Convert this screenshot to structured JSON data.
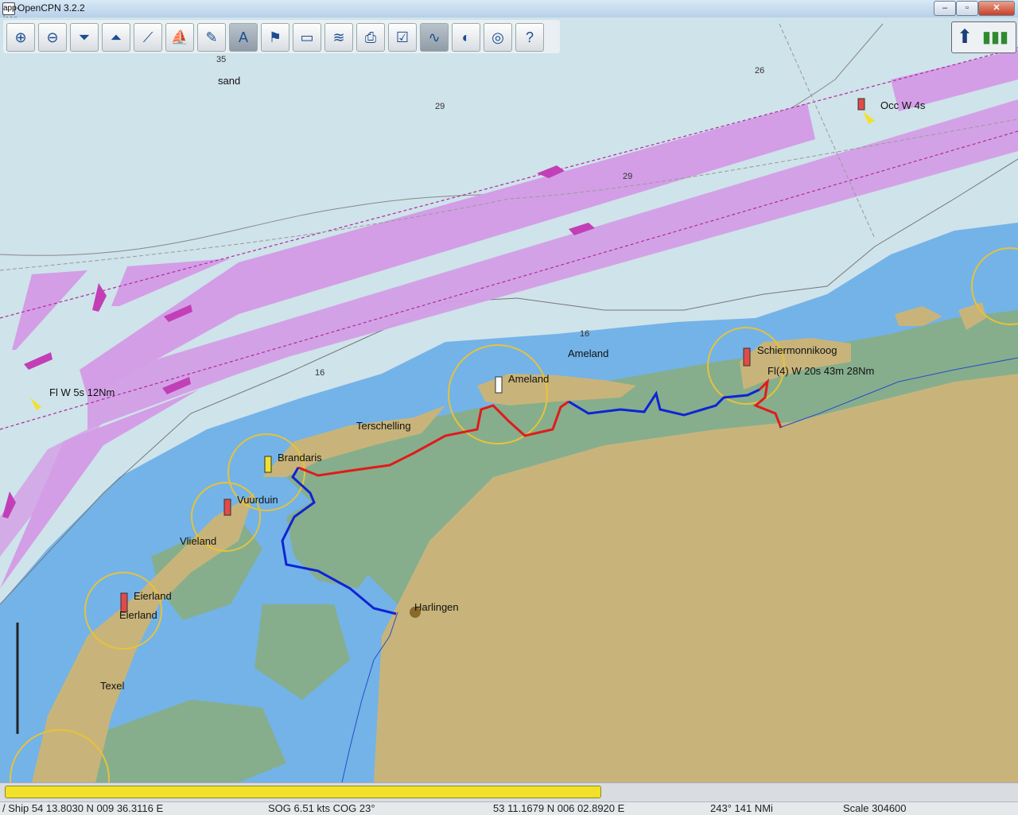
{
  "window": {
    "title": "OpenCPN 3.2.2",
    "icon": "app-icon",
    "minimize": "–",
    "maximize": "▫",
    "close": "✕"
  },
  "toolbar": {
    "buttons": [
      {
        "name": "zoom-in-icon",
        "glyph": "⊕"
      },
      {
        "name": "zoom-out-icon",
        "glyph": "⊖"
      },
      {
        "name": "scale-in-icon",
        "glyph": "⏷"
      },
      {
        "name": "scale-out-icon",
        "glyph": "⏶"
      },
      {
        "name": "route-icon",
        "glyph": "⟋"
      },
      {
        "name": "ship-icon",
        "glyph": "⛵"
      },
      {
        "name": "measure-icon",
        "glyph": "✎"
      },
      {
        "name": "text-icon",
        "glyph": "A"
      },
      {
        "name": "mark-icon",
        "glyph": "⚑"
      },
      {
        "name": "chart-toggle-icon",
        "glyph": "▭"
      },
      {
        "name": "tide-icon",
        "glyph": "≋"
      },
      {
        "name": "print-icon",
        "glyph": "⎙"
      },
      {
        "name": "settings-icon",
        "glyph": "☑"
      },
      {
        "name": "track-icon",
        "glyph": "∿"
      },
      {
        "name": "colorscheme-icon",
        "glyph": "◐"
      },
      {
        "name": "mob-icon",
        "glyph": "◎"
      },
      {
        "name": "help-icon",
        "glyph": "?"
      }
    ]
  },
  "chart": {
    "soundings": [
      "35",
      "29",
      "29",
      "26",
      "16",
      "16"
    ],
    "labels": {
      "sand": "sand",
      "light_north": "Occ W 4s",
      "light_west": "Fl W 5s 12Nm",
      "ameland_town": "Ameland",
      "ameland_light": "Ameland",
      "schiermonnikoog": "Schiermonnikoog",
      "schier_light": "Fl(4) W 20s 43m 28Nm",
      "terschelling": "Terschelling",
      "brandaris": "Brandaris",
      "vuurduin": "Vuurduin",
      "vlieland": "Vlieland",
      "eierland1": "Eierland",
      "eierland2": "Eierland",
      "texel": "Texel",
      "harlingen": "Harlingen"
    }
  },
  "progress": {
    "fraction": 0.59
  },
  "status": {
    "ship": "/ Ship 54 13.8030 N   009 36.3116 E",
    "sog": "SOG 6.51 kts   COG 23°",
    "cursor": "53 11.1679 N    006 02.8920 E",
    "bearing": "243°   141 NMi",
    "scale": "Scale 304600"
  },
  "colors": {
    "deep": "#cfe3ea",
    "shallow": "#73b3e8",
    "land": "#c8b47a",
    "drying": "#86ae8c",
    "tss": "#d39ee6",
    "track_red": "#e01b1b",
    "track_blue": "#0f23d6"
  }
}
